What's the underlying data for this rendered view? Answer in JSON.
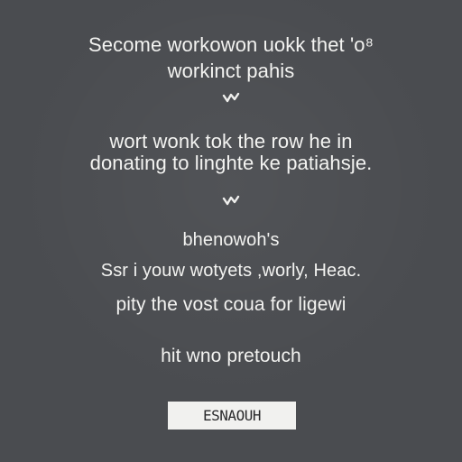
{
  "text_lines": [
    "Secome workowon uokk thet 'o⁸",
    "workinct pahis",
    "wort wonk tok the row he in",
    "donating to linghte ke patiahsje.",
    "bhenowoh's",
    "Ssr i youw wotyets ,worly, Heac.",
    "pity the vost coua for ligewi",
    "hit wno pretouch"
  ],
  "ornaments": [
    "divider-flourish-icon",
    "divider-flourish-icon"
  ],
  "label": "ESNAOUH",
  "colors": {
    "background": "#4a4c50",
    "text": "#f3f3f1",
    "label_background": "#f1f1ef",
    "label_text": "#2a2a2c"
  }
}
